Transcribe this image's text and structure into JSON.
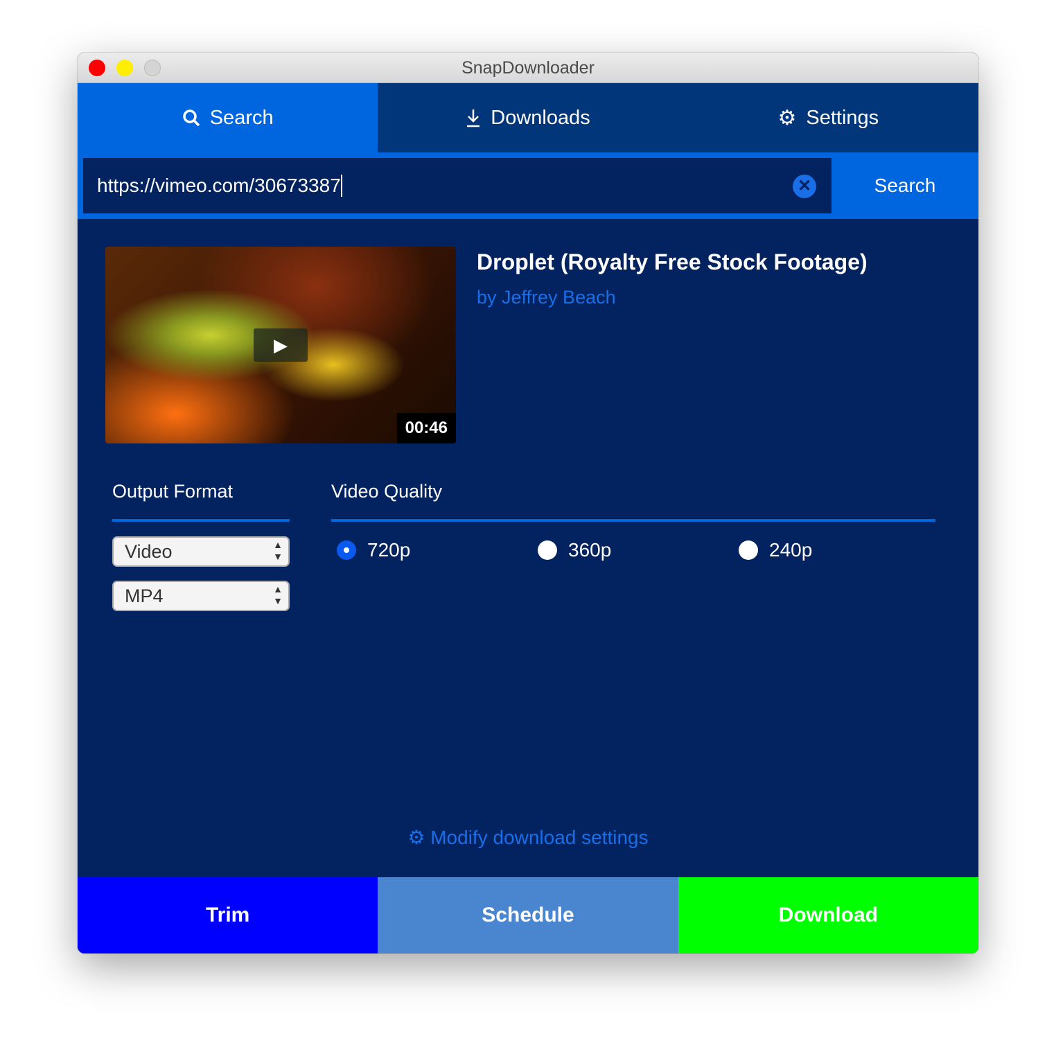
{
  "window": {
    "title": "SnapDownloader"
  },
  "tabs": [
    {
      "label": "Search",
      "icon": "search-icon"
    },
    {
      "label": "Downloads",
      "icon": "download-icon"
    },
    {
      "label": "Settings",
      "icon": "gear-icon"
    }
  ],
  "search": {
    "url": "https://vimeo.com/30673387",
    "button": "Search"
  },
  "video": {
    "title": "Droplet (Royalty Free Stock Footage)",
    "author": "by Jeffrey Beach",
    "duration": "00:46"
  },
  "format": {
    "label": "Output Format",
    "type": "Video",
    "container": "MP4"
  },
  "quality": {
    "label": "Video Quality",
    "options": [
      "720p",
      "360p",
      "240p"
    ],
    "selected": "720p"
  },
  "modify_link": "Modify download settings",
  "actions": {
    "trim": "Trim",
    "schedule": "Schedule",
    "download": "Download"
  },
  "colors": {
    "background": "#02235f",
    "accent": "#0066e0",
    "trim": "#0000ff",
    "schedule": "#4a86d0",
    "download": "#00ff00"
  }
}
